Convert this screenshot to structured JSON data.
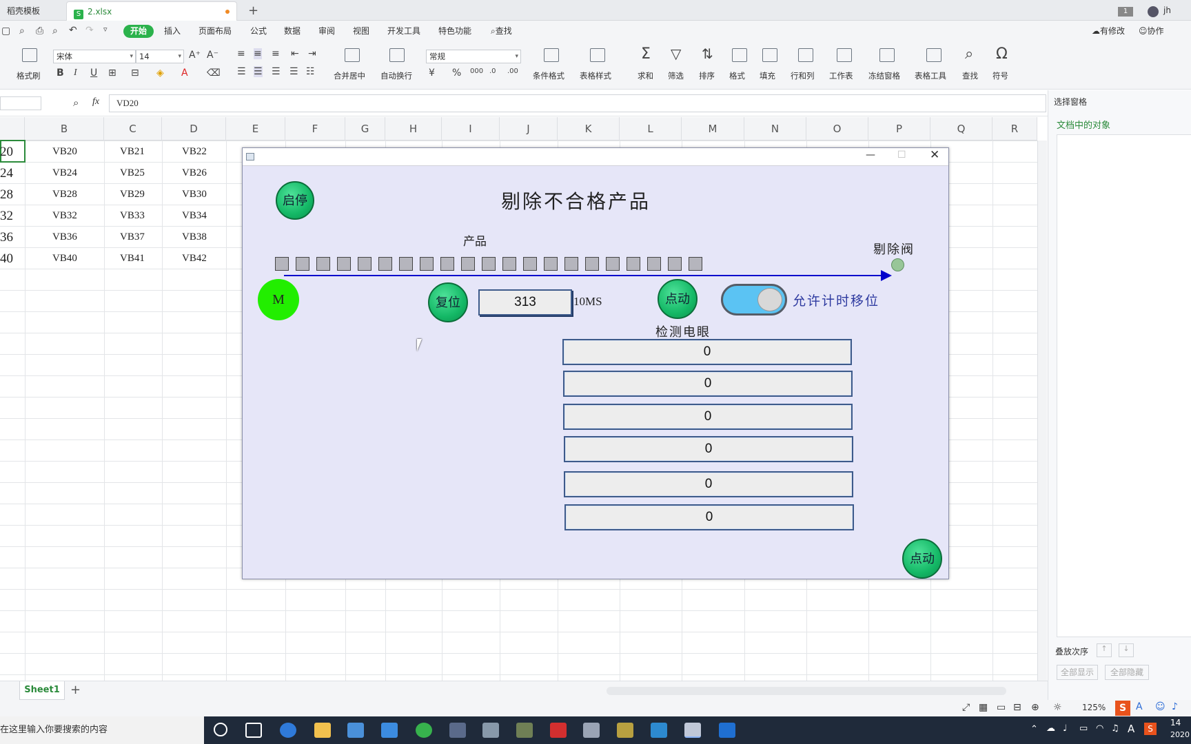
{
  "tabs": [
    {
      "label": "稻壳模板"
    },
    {
      "label": "2.xlsx",
      "icon": "S"
    }
  ],
  "menu": {
    "items": [
      "开始",
      "插入",
      "页面布局",
      "公式",
      "数据",
      "审阅",
      "视图",
      "开发工具",
      "特色功能",
      "查找"
    ],
    "right": [
      "有修改",
      "协作"
    ]
  },
  "ribbon": {
    "format_painter": "格式刷",
    "font_name": "宋体",
    "font_size": "14",
    "merge": "合并居中",
    "wrap": "自动换行",
    "number_format": "常规",
    "tools": [
      "条件格式",
      "表格样式",
      "求和",
      "筛选",
      "排序",
      "格式",
      "填充",
      "行和列",
      "工作表",
      "冻结窗格",
      "表格工具",
      "查找",
      "符号"
    ]
  },
  "formula_bar": {
    "fx": "fx",
    "value": "VD20"
  },
  "columns": [
    "B",
    "C",
    "D",
    "E",
    "F",
    "G",
    "H",
    "I",
    "J",
    "K",
    "L",
    "M",
    "N",
    "O",
    "P",
    "Q",
    "R"
  ],
  "rows": [
    {
      "a": "20",
      "b": "VB20",
      "c": "VB21",
      "d": "VB22"
    },
    {
      "a": "24",
      "b": "VB24",
      "c": "VB25",
      "d": "VB26"
    },
    {
      "a": "28",
      "b": "VB28",
      "c": "VB29",
      "d": "VB30"
    },
    {
      "a": "32",
      "b": "VB32",
      "c": "VB33",
      "d": "VB34"
    },
    {
      "a": "36",
      "b": "VB36",
      "c": "VB37",
      "d": "VB38"
    },
    {
      "a": "40",
      "b": "VB40",
      "c": "VB41",
      "d": "VB42"
    }
  ],
  "right_pane": {
    "title": "选择窗格",
    "subtitle": "文档中的对象",
    "order_label": "叠放次序",
    "show_all": "全部显示",
    "hide_all": "全部隐藏"
  },
  "sheet": {
    "name": "Sheet1"
  },
  "status": {
    "zoom": "125%"
  },
  "taskbar": {
    "search_placeholder": "在这里输入你要搜索的内容",
    "time": "14",
    "date": "2020",
    "user": "jh",
    "page_count": "1"
  },
  "hmi": {
    "title": "剔除不合格产品",
    "start_stop": "启停",
    "product_label": "产品",
    "valve_label": "剔除阀",
    "motor_label": "M",
    "reset_label": "复位",
    "counter_value": "313",
    "unit_label": "10MS",
    "jog_label": "点动",
    "allow_shift_label": "允许计时移位",
    "sensor_label": "检测电眼",
    "sensor_values": [
      "0",
      "0",
      "0",
      "0",
      "0",
      "0"
    ],
    "jog2_label": "点动",
    "colors": {
      "motor": "#22ee00",
      "button": "#14b866",
      "arrow": "#0000cc",
      "toggle": "#5bc3f3"
    }
  }
}
